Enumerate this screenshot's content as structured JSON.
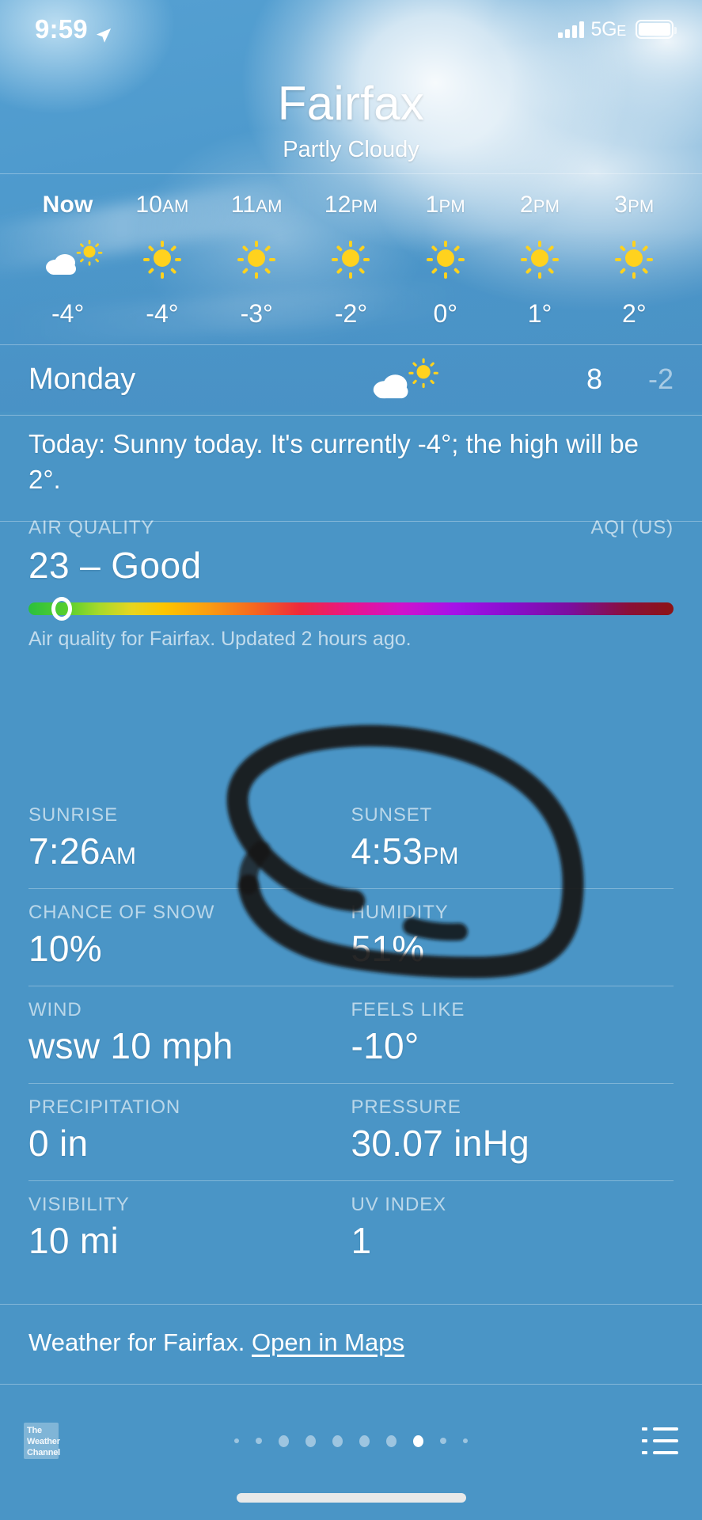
{
  "status_bar": {
    "time": "9:59",
    "location_arrow_icon": "location-arrow-icon",
    "signal_icon": "cellular-bars-icon",
    "network": "5G",
    "network_suffix": "E",
    "battery_icon": "battery-full-icon"
  },
  "hero": {
    "city": "Fairfax",
    "condition": "Partly Cloudy"
  },
  "hourly": {
    "items": [
      {
        "label": "Now",
        "label_suffix": "",
        "icon": "partly-cloudy-icon",
        "temp": "-4°"
      },
      {
        "label": "10",
        "label_suffix": "AM",
        "icon": "sun-icon",
        "temp": "-4°"
      },
      {
        "label": "11",
        "label_suffix": "AM",
        "icon": "sun-icon",
        "temp": "-3°"
      },
      {
        "label": "12",
        "label_suffix": "PM",
        "icon": "sun-icon",
        "temp": "-2°"
      },
      {
        "label": "1",
        "label_suffix": "PM",
        "icon": "sun-icon",
        "temp": "0°"
      },
      {
        "label": "2",
        "label_suffix": "PM",
        "icon": "sun-icon",
        "temp": "1°"
      },
      {
        "label": "3",
        "label_suffix": "PM",
        "icon": "sun-icon",
        "temp": "2°"
      }
    ]
  },
  "daily": {
    "day": "Monday",
    "icon": "partly-cloudy-icon",
    "high": "8",
    "low": "-2"
  },
  "summary": {
    "text": "Today: Sunny today. It's currently -4°; the high will be 2°."
  },
  "air_quality": {
    "label": "AIR QUALITY",
    "scale_label": "AQI (US)",
    "value": "23 – Good",
    "index": 23,
    "note": "Air quality for Fairfax. Updated 2 hours ago.",
    "bar_colors": [
      "#2bc03c",
      "#e8d520",
      "#fdc500",
      "#f5671f",
      "#ee2a3c",
      "#e8158c",
      "#a512e8",
      "#7b0f9e",
      "#8c1416"
    ]
  },
  "details": {
    "rows": [
      [
        {
          "label": "SUNRISE",
          "value": "7:26",
          "suffix": "AM"
        },
        {
          "label": "SUNSET",
          "value": "4:53",
          "suffix": "PM"
        }
      ],
      [
        {
          "label": "CHANCE OF SNOW",
          "value": "10%",
          "suffix": ""
        },
        {
          "label": "HUMIDITY",
          "value": "51%",
          "suffix": ""
        }
      ],
      [
        {
          "label": "WIND",
          "value": "wsw 10 mph",
          "suffix": ""
        },
        {
          "label": "FEELS LIKE",
          "value": "-10°",
          "suffix": ""
        }
      ],
      [
        {
          "label": "PRECIPITATION",
          "value": "0 in",
          "suffix": ""
        },
        {
          "label": "PRESSURE",
          "value": "30.07 inHg",
          "suffix": ""
        }
      ],
      [
        {
          "label": "VISIBILITY",
          "value": "10 mi",
          "suffix": ""
        },
        {
          "label": "UV INDEX",
          "value": "1",
          "suffix": ""
        }
      ]
    ]
  },
  "footer": {
    "text": "Weather for Fairfax.",
    "link": "Open in Maps"
  },
  "bottom_bar": {
    "brand_line1": "The",
    "brand_line2": "Weather",
    "brand_line3": "Channel",
    "page_count": 10,
    "active_page": 8,
    "list_icon": "list-view-icon"
  },
  "annotation": {
    "type": "handwritten-circle",
    "color": "#17181a",
    "targets": [
      "HUMIDITY",
      "FEELS LIKE",
      "PRESSURE"
    ]
  }
}
